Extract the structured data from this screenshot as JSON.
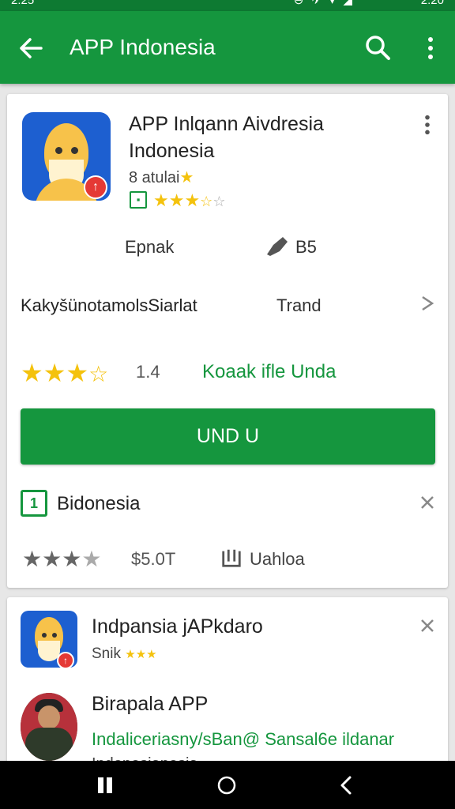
{
  "status_bar": {
    "time_left": "2:25",
    "time_right": "2:20"
  },
  "app_bar": {
    "title": "APP Indonesia"
  },
  "card1": {
    "app_title": "APP Inlqann Aivdresia",
    "app_title_line2": "Indonesia",
    "developer": "8 atulai",
    "stat_left": "Epnak",
    "stat_right": "B5",
    "row_left": "KakyšünotamolsSiarlat",
    "row_mid": "Trand",
    "rating_value": "1.4",
    "rating_link": "Koaak ifle Unda",
    "install_label": "UND U",
    "section_label": "Bidonesia",
    "price": "$5.0T",
    "download_label": "Uahloa"
  },
  "card2": {
    "item1_title": "Indpansia jAPkdaro",
    "item1_sub": "Snik",
    "item2_title": "Birapala APP",
    "item2_link": "Indaliceriasny/sBan@ Sansal6e ildanar",
    "item2_desc": "Indonesianesia"
  },
  "colors": {
    "brand_green": "#15963e",
    "status_green": "#0e7a32",
    "star_yellow": "#f4c20d",
    "badge_red": "#e53935"
  }
}
